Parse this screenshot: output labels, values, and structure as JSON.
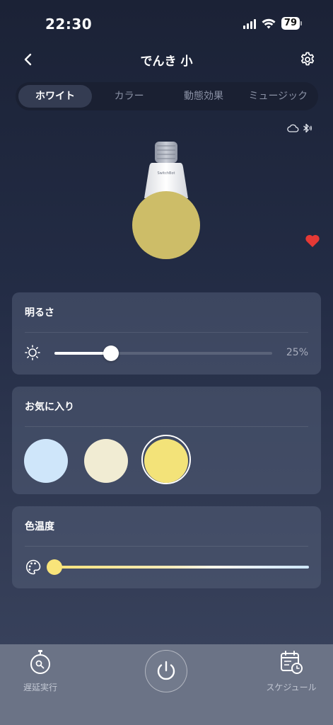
{
  "status_bar": {
    "time": "22:30",
    "battery": "79",
    "icons": [
      "cellular-signal-icon",
      "wifi-icon",
      "battery-icon"
    ]
  },
  "header": {
    "title": "でんき 小",
    "back_icon": "chevron-left-icon",
    "settings_icon": "gear-icon"
  },
  "tabs": [
    {
      "label": "ホワイト",
      "active": true
    },
    {
      "label": "カラー",
      "active": false
    },
    {
      "label": "動態効果",
      "active": false
    },
    {
      "label": "ミュージック",
      "active": false
    }
  ],
  "connection_icons": [
    "cloud-icon",
    "bluetooth-icon"
  ],
  "bulb": {
    "brand": "SwitchBot",
    "glow_color": "#cdbd68"
  },
  "favorite_toggle": {
    "icon": "heart-icon",
    "active": true,
    "color": "#e53935"
  },
  "brightness": {
    "title": "明るさ",
    "value_label": "25%",
    "value": 0.26,
    "icon": "sun-icon"
  },
  "favorites": {
    "title": "お気に入り",
    "presets": [
      {
        "color": "#cfe6fa",
        "selected": false
      },
      {
        "color": "#f1ecd3",
        "selected": false
      },
      {
        "color": "#f3e379",
        "selected": true
      }
    ]
  },
  "color_temperature": {
    "title": "色温度",
    "icon": "palette-icon",
    "value": 0.0
  },
  "bottom_bar": {
    "delay_label": "遅延実行",
    "delay_icon": "timer-icon",
    "power_icon": "power-icon",
    "schedule_label": "スケジュール",
    "schedule_icon": "calendar-clock-icon"
  },
  "colors": {
    "accent_yellow": "#f8e47a",
    "card_bg": "#4a536c",
    "bottom_bar_bg": "#6b7386"
  }
}
